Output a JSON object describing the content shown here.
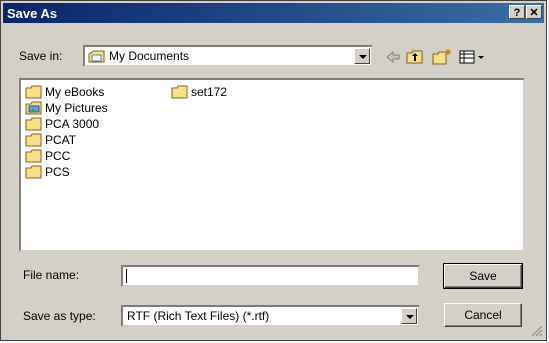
{
  "window": {
    "title": "Save As",
    "help_glyph": "?",
    "close_glyph": "✕"
  },
  "toolbar": {
    "save_in_label": "Save in:",
    "location": "My Documents",
    "back_icon": "back-arrow-icon",
    "up_icon": "up-folder-icon",
    "new_folder_icon": "new-folder-icon",
    "views_icon": "views-menu-icon"
  },
  "files": [
    {
      "name": "My eBooks",
      "icon": "folder-icon"
    },
    {
      "name": "My Pictures",
      "icon": "pictures-folder-icon"
    },
    {
      "name": "PCA 3000",
      "icon": "folder-icon"
    },
    {
      "name": "PCAT",
      "icon": "folder-icon"
    },
    {
      "name": "PCC",
      "icon": "folder-icon"
    },
    {
      "name": "PCS",
      "icon": "folder-icon"
    },
    {
      "name": "set172",
      "icon": "folder-icon"
    }
  ],
  "form": {
    "file_name_label": "File name:",
    "file_name_value": "",
    "save_as_type_label": "Save as type:",
    "save_as_type_value": "RTF (Rich Text Files) (*.rtf)"
  },
  "buttons": {
    "save": "Save",
    "cancel": "Cancel"
  },
  "colors": {
    "titlebar_start": "#0a246a",
    "titlebar_end": "#3a6ea5",
    "dialog_face": "#d4d0c8",
    "folder": "#f8e08a"
  }
}
